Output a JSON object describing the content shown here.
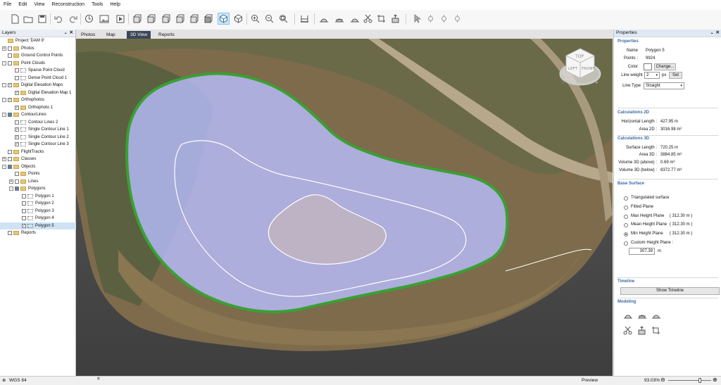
{
  "menu": [
    "File",
    "Edit",
    "View",
    "Reconstruction",
    "Tools",
    "Help"
  ],
  "layers_panel": {
    "title": "Layers",
    "tree": [
      {
        "label": "Project 'DAM 9'",
        "level": 0,
        "exp": "",
        "check": "none",
        "icon": "folder"
      },
      {
        "label": "Photos",
        "level": 0,
        "exp": "+",
        "check": "box",
        "icon": "folder"
      },
      {
        "label": "Ground Control Points",
        "level": 0,
        "exp": "",
        "check": "box",
        "icon": "folder"
      },
      {
        "label": "Point Clouds",
        "level": 0,
        "exp": "-",
        "check": "box",
        "icon": "folder"
      },
      {
        "label": "Sparse Point Cloud",
        "level": 1,
        "exp": "",
        "check": "box",
        "icon": "leaf"
      },
      {
        "label": "Dense Point Cloud 1",
        "level": 1,
        "exp": "",
        "check": "box",
        "icon": "leaf"
      },
      {
        "label": "Digital Elevation Maps",
        "level": 0,
        "exp": "-",
        "check": "checked",
        "icon": "folder"
      },
      {
        "label": "Digital Elevation Map 1",
        "level": 1,
        "exp": "",
        "check": "checked",
        "icon": "folder"
      },
      {
        "label": "Orthophotos",
        "level": 0,
        "exp": "-",
        "check": "checked",
        "icon": "folder"
      },
      {
        "label": "Orthophoto 1",
        "level": 1,
        "exp": "",
        "check": "checked",
        "icon": "folder"
      },
      {
        "label": "ContourLines",
        "level": 0,
        "exp": "-",
        "check": "partial",
        "icon": "folder"
      },
      {
        "label": "Contour Lines 2",
        "level": 1,
        "exp": "",
        "check": "box",
        "icon": "leaf"
      },
      {
        "label": "Single Contour Line 1",
        "level": 1,
        "exp": "",
        "check": "checked",
        "icon": "leaf"
      },
      {
        "label": "Single Contour Line 2",
        "level": 1,
        "exp": "",
        "check": "checked",
        "icon": "leaf"
      },
      {
        "label": "Single Contour Line 3",
        "level": 1,
        "exp": "",
        "check": "checked",
        "icon": "leaf"
      },
      {
        "label": "FlightTracks",
        "level": 0,
        "exp": "",
        "check": "box",
        "icon": "folder"
      },
      {
        "label": "Classes",
        "level": 0,
        "exp": "+",
        "check": "box",
        "icon": "folder"
      },
      {
        "label": "Objects",
        "level": 0,
        "exp": "-",
        "check": "partial",
        "icon": "folder"
      },
      {
        "label": "Points",
        "level": 1,
        "exp": "",
        "check": "box",
        "icon": "folder"
      },
      {
        "label": "Lines",
        "level": 1,
        "exp": "+",
        "check": "box",
        "icon": "folder"
      },
      {
        "label": "Polygons",
        "level": 1,
        "exp": "-",
        "check": "partial",
        "icon": "folder"
      },
      {
        "label": "Polygon 1",
        "level": 2,
        "exp": "",
        "check": "box",
        "icon": "leaf"
      },
      {
        "label": "Polygon 2",
        "level": 2,
        "exp": "",
        "check": "box",
        "icon": "leaf"
      },
      {
        "label": "Polygon 3",
        "level": 2,
        "exp": "",
        "check": "box",
        "icon": "leaf"
      },
      {
        "label": "Polygon 4",
        "level": 2,
        "exp": "",
        "check": "box",
        "icon": "leaf"
      },
      {
        "label": "Polygon 5",
        "level": 2,
        "exp": "",
        "check": "checked",
        "icon": "leaf",
        "selected": true
      },
      {
        "label": "Reports",
        "level": 0,
        "exp": "",
        "check": "box",
        "icon": "folder"
      }
    ]
  },
  "tabs": [
    {
      "label": "Photos",
      "active": false
    },
    {
      "label": "Map",
      "active": false
    },
    {
      "label": "3D View",
      "active": true
    },
    {
      "label": "Reports",
      "active": false
    }
  ],
  "viewcube": {
    "top": "TOP",
    "left": "LEFT",
    "front": "FRONT",
    "compass": "W"
  },
  "properties_panel": {
    "title": "Properties",
    "section_properties": "Properties",
    "name_label": "Name",
    "name_value": "Polygon 5",
    "points_label": "Points :",
    "points_value": "9924",
    "color_label": "Color",
    "color_value": "#ffffff",
    "change_button": "Change...",
    "lineweight_label": "Line weight :",
    "lineweight_value": "2",
    "lineweight_unit": "px",
    "set_button": "Set",
    "linetype_label": "Line Type",
    "linetype_value": "Straight",
    "section_calc2d": "Calculations 2D",
    "hlen_label": "Horizontal Length :",
    "hlen_value": "427.95 m",
    "area2d_label": "Area 2D :",
    "area2d_value": "3016.98 m²",
    "section_calc3d": "Calculations 3D",
    "slen_label": "Surface Length :",
    "slen_value": "720.25 m",
    "area3d_label": "Area 3D :",
    "area3d_value": "3884.85 m²",
    "vabove_label": "Volume 3D (above) :",
    "vabove_value": "0.69 m³",
    "vbelow_label": "Volume 3D (below) :",
    "vbelow_value": "8372.77 m³",
    "section_base": "Base Surface",
    "base_options": [
      {
        "label": "Triangulated surface",
        "value": "",
        "selected": false
      },
      {
        "label": "Fitted Plane",
        "value": "",
        "selected": false
      },
      {
        "label": "Max Height Plane",
        "value": "( 312.30 m )",
        "selected": false
      },
      {
        "label": "Mean Height Plane",
        "value": "( 312.30 m )",
        "selected": false
      },
      {
        "label": "Min Height Plane",
        "value": "( 312.30 m )",
        "selected": true
      },
      {
        "label": "Custom Height Plane :",
        "value": "",
        "selected": false
      }
    ],
    "custom_value": "307.39",
    "custom_unit": "m",
    "section_timeline": "Timeline",
    "show_timeline_button": "Show Timeline",
    "section_modeling": "Modeling"
  },
  "status": {
    "crs": "WGS 84",
    "mode": "Preview",
    "zoom": "93.03%",
    "zoom_level": 0.74
  },
  "colors": {
    "accent": "#3b6aa4",
    "polygon_outline": "#3aa033",
    "polygon_fill": "#b9bfff",
    "contour": "#ffffff",
    "active_tab": "#3b4757"
  }
}
